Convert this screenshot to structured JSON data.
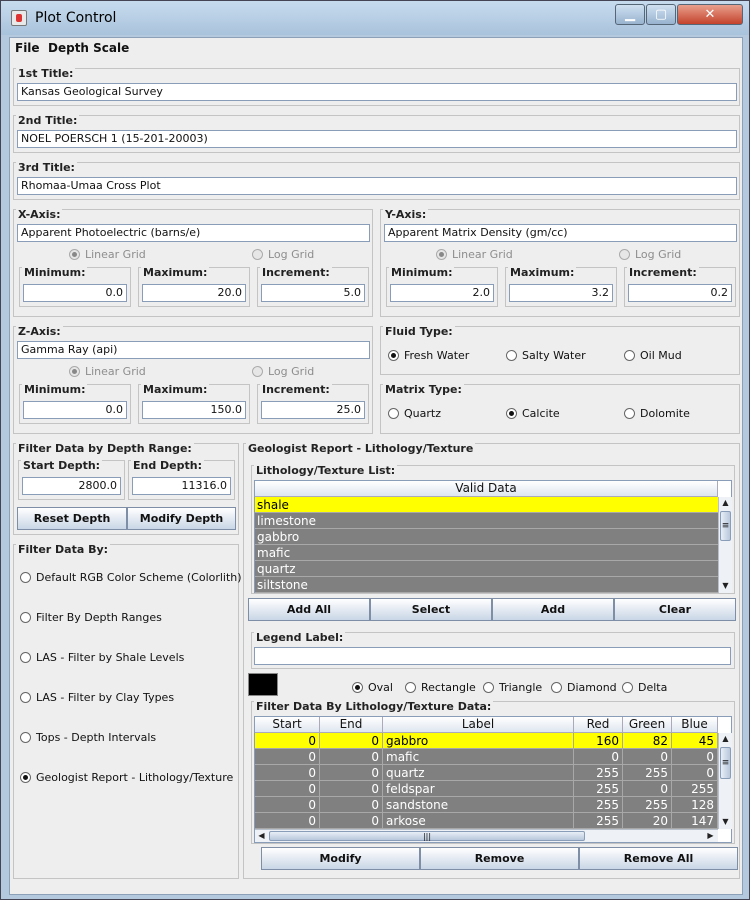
{
  "window": {
    "title": "Plot Control",
    "min_glyph": "▁",
    "max_glyph": "▢",
    "close_glyph": "✕"
  },
  "menu": {
    "file": "File",
    "depth_scale": "Depth Scale"
  },
  "titles": {
    "first_label": "1st Title:",
    "first_value": "Kansas Geological Survey",
    "second_label": "2nd Title:",
    "second_value": "NOEL POERSCH 1 (15-201-20003)",
    "third_label": "3rd Title:",
    "third_value": "Rhomaa-Umaa Cross Plot"
  },
  "x_axis": {
    "label": "X-Axis:",
    "name": "Apparent Photoelectric (barns/e)",
    "linear": "Linear Grid",
    "log": "Log Grid",
    "min_label": "Minimum:",
    "min": "0.0",
    "max_label": "Maximum:",
    "max": "20.0",
    "inc_label": "Increment:",
    "inc": "5.0"
  },
  "y_axis": {
    "label": "Y-Axis:",
    "name": "Apparent Matrix Density (gm/cc)",
    "linear": "Linear Grid",
    "log": "Log Grid",
    "min_label": "Minimum:",
    "min": "2.0",
    "max_label": "Maximum:",
    "max": "3.2",
    "inc_label": "Increment:",
    "inc": "0.2"
  },
  "z_axis": {
    "label": "Z-Axis:",
    "name": "Gamma Ray (api)",
    "linear": "Linear Grid",
    "log": "Log Grid",
    "min_label": "Minimum:",
    "min": "0.0",
    "max_label": "Maximum:",
    "max": "150.0",
    "inc_label": "Increment:",
    "inc": "25.0"
  },
  "fluid": {
    "label": "Fluid Type:",
    "fresh": "Fresh Water",
    "salty": "Salty Water",
    "oil": "Oil Mud"
  },
  "matrix": {
    "label": "Matrix Type:",
    "quartz": "Quartz",
    "calcite": "Calcite",
    "dolomite": "Dolomite"
  },
  "depth_filter": {
    "label": "Filter Data by Depth Range:",
    "start_label": "Start Depth:",
    "start": "2800.0",
    "end_label": "End Depth:",
    "end": "11316.0",
    "reset": "Reset Depth",
    "modify": "Modify Depth"
  },
  "filter_by": {
    "label": "Filter Data By:",
    "options": [
      "Default RGB Color Scheme (Colorlith)",
      "Filter By Depth Ranges",
      "LAS - Filter by Shale Levels",
      "LAS - Filter by Clay Types",
      "Tops - Depth Intervals",
      "Geologist Report - Lithology/Texture"
    ]
  },
  "geologist": {
    "label": "Geologist Report - Lithology/Texture",
    "list_label": "Lithology/Texture List:",
    "list_header": "Valid Data",
    "list_items": [
      "shale",
      "limestone",
      "gabbro",
      "mafic",
      "quartz",
      "siltstone"
    ],
    "add_all": "Add All",
    "select": "Select",
    "add": "Add",
    "clear": "Clear",
    "legend_label": "Legend Label:",
    "legend_value": "",
    "shapes": {
      "oval": "Oval",
      "rectangle": "Rectangle",
      "triangle": "Triangle",
      "diamond": "Diamond",
      "delta": "Delta"
    },
    "filter_label": "Filter Data By Lithology/Texture Data:",
    "columns": {
      "start": "Start",
      "end": "End",
      "label": "Label",
      "red": "Red",
      "green": "Green",
      "blue": "Blue"
    },
    "rows": [
      {
        "start": "0",
        "end": "0",
        "label": "gabbro",
        "red": "160",
        "green": "82",
        "blue": "45"
      },
      {
        "start": "0",
        "end": "0",
        "label": "mafic",
        "red": "0",
        "green": "0",
        "blue": "0"
      },
      {
        "start": "0",
        "end": "0",
        "label": "quartz",
        "red": "255",
        "green": "255",
        "blue": "0"
      },
      {
        "start": "0",
        "end": "0",
        "label": "feldspar",
        "red": "255",
        "green": "0",
        "blue": "255"
      },
      {
        "start": "0",
        "end": "0",
        "label": "sandstone",
        "red": "255",
        "green": "255",
        "blue": "128"
      },
      {
        "start": "0",
        "end": "0",
        "label": "arkose",
        "red": "255",
        "green": "20",
        "blue": "147"
      }
    ],
    "modify": "Modify",
    "remove": "Remove",
    "remove_all": "Remove All"
  },
  "icons": {
    "up": "▲",
    "down": "▼",
    "left": "◀",
    "right": "▶",
    "grip": "≡",
    "hgrip": "|||"
  },
  "colors": {
    "selection": "#ffff00",
    "row_bg": "#808080",
    "legend_swatch": "#000000"
  }
}
